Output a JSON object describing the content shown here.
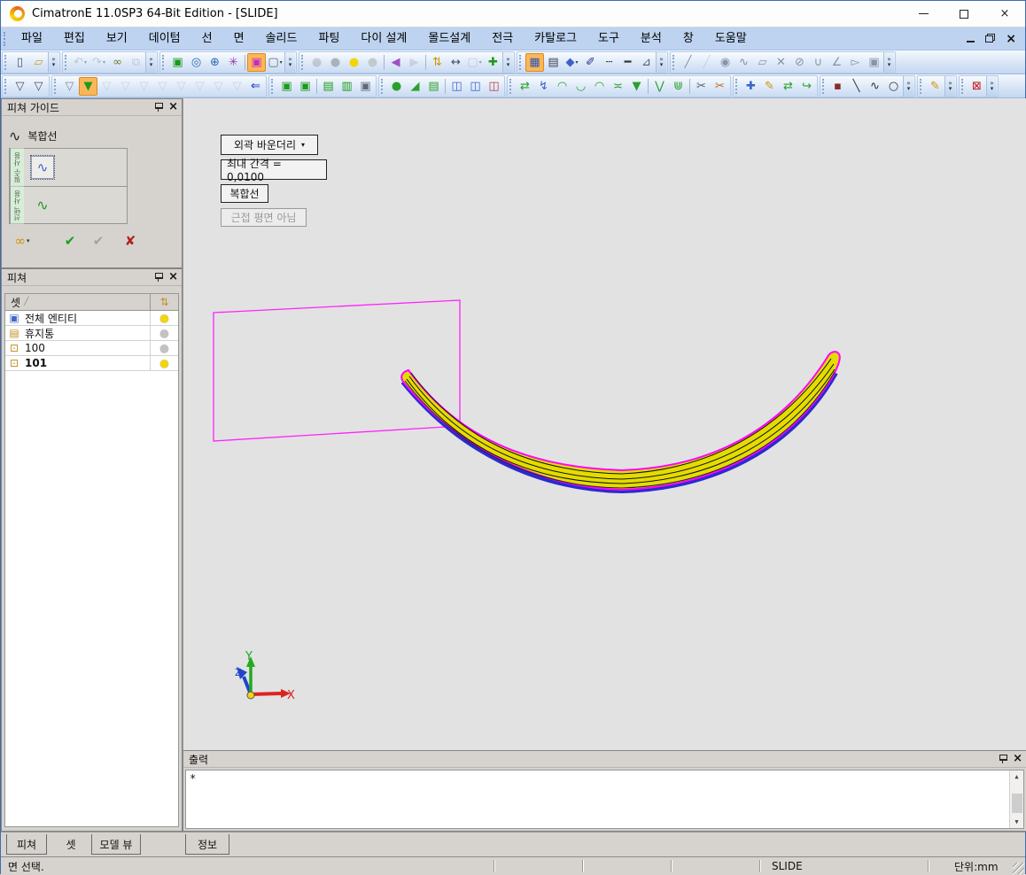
{
  "window": {
    "title": "CimatronE 11.0SP3 64-Bit Edition - [SLIDE]",
    "close_glyph": "×"
  },
  "menu": {
    "items": [
      "파일",
      "편집",
      "보기",
      "데이텀",
      "선",
      "면",
      "솔리드",
      "파팅",
      "다이 설계",
      "몰드설계",
      "전극",
      "카탈로그",
      "도구",
      "분석",
      "창",
      "도움말"
    ],
    "doc_close_glyph": "×"
  },
  "toolbars": {
    "row1": [
      {
        "name": "file",
        "overflow": true,
        "icons": [
          {
            "n": "new-file-icon",
            "g": "▯",
            "c": "#445a77"
          },
          {
            "n": "open-file-icon",
            "g": "▱",
            "c": "#d49a1a"
          }
        ]
      },
      {
        "name": "edit",
        "overflow": true,
        "icons": [
          {
            "n": "undo-icon",
            "g": "↶",
            "c": "#8899aa",
            "gray": 1,
            "dd": 1
          },
          {
            "n": "redo-icon",
            "g": "↷",
            "c": "#8899aa",
            "gray": 1,
            "dd": 1
          },
          {
            "n": "entity-links-icon",
            "g": "∞",
            "c": "#6a7d2e"
          },
          {
            "n": "copy-geometry-icon",
            "g": "⧉",
            "c": "#99a0aa",
            "gray": 1
          }
        ]
      },
      {
        "name": "view",
        "overflow": true,
        "icons": [
          {
            "n": "zoom-all-icon",
            "g": "▣",
            "c": "#1d9a1d"
          },
          {
            "n": "zoom-dynamic-icon",
            "g": "◎",
            "c": "#2a6ab0"
          },
          {
            "n": "zoom-window-icon",
            "g": "⊕",
            "c": "#2a6ab0"
          },
          {
            "n": "orbit-view-icon",
            "g": "✳",
            "c": "#9a35a8"
          },
          {
            "sep": 1
          },
          {
            "n": "shaded-mode-icon",
            "g": "▣",
            "c": "#c52cc5",
            "hl": 1
          },
          {
            "n": "wireframe-mode-icon",
            "g": "▢",
            "c": "#606a78",
            "dd": 1
          }
        ]
      },
      {
        "name": "visibility",
        "overflow": true,
        "icons": [
          {
            "n": "hide-by-cursor-icon",
            "g": "●",
            "c": "#9aa0a8",
            "gray": 1
          },
          {
            "n": "bulb-off-icon",
            "g": "●",
            "c": "#aab2ba"
          },
          {
            "n": "bulb-on-icon",
            "g": "●",
            "c": "#f2d50a"
          },
          {
            "n": "show-by-cursor-icon",
            "g": "●",
            "c": "#c3c9cf"
          },
          {
            "sep": 1
          },
          {
            "n": "previous-display-icon",
            "g": "◀",
            "c": "#a050c0"
          },
          {
            "n": "next-display-icon",
            "g": "▶",
            "c": "#aeb6be",
            "gray": 1
          },
          {
            "sep": 1
          },
          {
            "n": "swap-visibility-icon",
            "g": "⇅",
            "c": "#cf9400"
          },
          {
            "n": "measure-icon",
            "g": "↔",
            "c": "#44506a"
          },
          {
            "n": "box-display-icon",
            "g": "▢",
            "c": "#99a0aa",
            "gray": 1,
            "dd": 1
          },
          {
            "n": "add-part-icon",
            "g": "✚",
            "c": "#1d9a1d"
          }
        ]
      },
      {
        "name": "attributes",
        "overflow": true,
        "icons": [
          {
            "n": "uv-lines-icon",
            "g": "▦",
            "c": "#2a5ab8",
            "hl": 1
          },
          {
            "n": "color-table-icon",
            "g": "▤",
            "c": "#3a4250"
          },
          {
            "n": "fill-color-icon",
            "g": "◆",
            "c": "#3a62c8",
            "dd": 1
          },
          {
            "n": "pick-attribute-icon",
            "g": "✐",
            "c": "#24368a"
          },
          {
            "n": "line-style-icon",
            "g": "┄",
            "c": "#333333"
          },
          {
            "n": "line-width-icon",
            "g": "━",
            "c": "#333333"
          },
          {
            "n": "paint-attributes-icon",
            "g": "⊿",
            "c": "#50607a"
          }
        ]
      },
      {
        "name": "snap",
        "overflow": true,
        "icons": [
          {
            "n": "snap-endpoint-icon",
            "g": "╱",
            "c": "#8892a8"
          },
          {
            "n": "snap-midpoint-icon",
            "g": "╱",
            "c": "#aab2ba",
            "gray": 1
          },
          {
            "n": "snap-center-icon",
            "g": "◉",
            "c": "#8892a8"
          },
          {
            "n": "snap-spline-icon",
            "g": "∿",
            "c": "#8892a8"
          },
          {
            "n": "snap-plane-icon",
            "g": "▱",
            "c": "#8892a8"
          },
          {
            "n": "snap-intersection-icon",
            "g": "✕",
            "c": "#8892a8"
          },
          {
            "n": "snap-hidden-icon",
            "g": "⊘",
            "c": "#8892a8"
          },
          {
            "n": "snap-on-curve-icon",
            "g": "∪",
            "c": "#8892a8"
          },
          {
            "n": "snap-axis-icon",
            "g": "∠",
            "c": "#8892a8"
          },
          {
            "n": "snap-free-icon",
            "g": "▻",
            "c": "#8892a8"
          },
          {
            "n": "snap-grid-icon",
            "g": "▣",
            "c": "#8892a8"
          }
        ]
      }
    ],
    "row2": [
      {
        "name": "filter-pick",
        "icons": [
          {
            "n": "filter-by-cursor-icon",
            "g": "▽",
            "c": "#44506a"
          },
          {
            "n": "filter-add-icon",
            "g": "▽",
            "c": "#44506a"
          }
        ]
      },
      {
        "name": "filters",
        "icons": [
          {
            "n": "filter-copies-icon",
            "g": "▽",
            "c": "#7a88a0"
          },
          {
            "n": "filter-active-icon",
            "g": "▼",
            "c": "#1d9a1d",
            "hl": 1
          },
          {
            "n": "filter-curves-icon",
            "g": "▽",
            "c": "#aab2ba",
            "gray": 1
          },
          {
            "n": "filter-arcs-icon",
            "g": "▽",
            "c": "#aab2ba",
            "gray": 1
          },
          {
            "n": "filter-points-icon",
            "g": "▽",
            "c": "#aab2ba",
            "gray": 1
          },
          {
            "n": "filter-planes-icon",
            "g": "▽",
            "c": "#aab2ba",
            "gray": 1
          },
          {
            "n": "filter-surfaces-icon",
            "g": "▽",
            "c": "#aab2ba",
            "gray": 1
          },
          {
            "n": "filter-solids-icon",
            "g": "▽",
            "c": "#aab2ba",
            "gray": 1
          },
          {
            "n": "filter-sets-icon",
            "g": "▽",
            "c": "#aab2ba",
            "gray": 1
          },
          {
            "n": "filter-dimensions-icon",
            "g": "▽",
            "c": "#aab2ba",
            "gray": 1
          },
          {
            "n": "filter-reset-icon",
            "g": "⇐",
            "c": "#1133cc"
          }
        ]
      },
      {
        "name": "sets",
        "icons": [
          {
            "n": "create-set-icon",
            "g": "▣",
            "c": "#1d9a1d"
          },
          {
            "n": "load-set-icon",
            "g": "▣",
            "c": "#1d9a1d"
          },
          {
            "sep": 1
          },
          {
            "n": "open-box-icon",
            "g": "▤",
            "c": "#1d9a1d"
          },
          {
            "n": "copy-box-icon",
            "g": "▥",
            "c": "#1d9a1d"
          },
          {
            "n": "frame-box-icon",
            "g": "▣",
            "c": "#606a78"
          }
        ]
      },
      {
        "name": "solids",
        "icons": [
          {
            "n": "solid-fillet-icon",
            "g": "●",
            "c": "#2ca02c"
          },
          {
            "n": "solid-chamfer-icon",
            "g": "◢",
            "c": "#2ca02c"
          },
          {
            "n": "solid-open-icon",
            "g": "▤",
            "c": "#2ca02c"
          },
          {
            "sep": 1
          },
          {
            "n": "split-one-icon",
            "g": "◫",
            "c": "#3a62c8"
          },
          {
            "n": "split-two-icon",
            "g": "◫",
            "c": "#3a62c8"
          },
          {
            "n": "split-three-icon",
            "g": "◫",
            "c": "#c23a3a"
          }
        ]
      },
      {
        "name": "surfaces",
        "icons": [
          {
            "n": "surface-offset-icon",
            "g": "⇄",
            "c": "#2ca02c"
          },
          {
            "n": "surface-twist-icon",
            "g": "↯",
            "c": "#3a62c8"
          },
          {
            "n": "surface-dome-icon",
            "g": "◠",
            "c": "#2ca02c"
          },
          {
            "n": "surface-bend-icon",
            "g": "◡",
            "c": "#2ca02c"
          },
          {
            "n": "surface-flange-icon",
            "g": "◠",
            "c": "#2ca02c"
          },
          {
            "n": "surface-extend-icon",
            "g": "≍",
            "c": "#2ca02c"
          },
          {
            "n": "surface-funnel-icon",
            "g": "▼",
            "c": "#2ca02c"
          },
          {
            "sep": 1
          },
          {
            "n": "trim-icon",
            "g": "⋁",
            "c": "#2ca02c"
          },
          {
            "n": "untrim-icon",
            "g": "⋓",
            "c": "#2ca02c"
          },
          {
            "sep": 1
          },
          {
            "n": "cut-by-curve-icon",
            "g": "✂",
            "c": "#50607a"
          },
          {
            "n": "cut-by-plane-icon",
            "g": "✂",
            "c": "#c06a1a"
          }
        ]
      },
      {
        "name": "transform",
        "icons": [
          {
            "n": "move-icon",
            "g": "✚",
            "c": "#3a62c8"
          },
          {
            "n": "move-edit-icon",
            "g": "✎",
            "c": "#cf9400"
          },
          {
            "n": "mirror-icon",
            "g": "⇄",
            "c": "#2ca02c"
          },
          {
            "n": "transform-arrow-icon",
            "g": "↪",
            "c": "#2ca02c"
          }
        ]
      },
      {
        "name": "wire-geometry",
        "overflow": true,
        "icons": [
          {
            "n": "point-icon",
            "g": "▪",
            "c": "#8a2a2a"
          },
          {
            "n": "line-icon",
            "g": "╲",
            "c": "#333333"
          },
          {
            "n": "spline-icon",
            "g": "∿",
            "c": "#333333"
          },
          {
            "n": "circle-icon",
            "g": "○",
            "c": "#333333"
          }
        ]
      },
      {
        "name": "sketcher",
        "overflow": true,
        "icons": [
          {
            "n": "sketcher-icon",
            "g": "✎",
            "c": "#cf9400"
          }
        ]
      },
      {
        "name": "delete",
        "overflow": true,
        "icons": [
          {
            "n": "delete-entities-icon",
            "g": "⊠",
            "c": "#cc1111"
          }
        ]
      }
    ]
  },
  "guide_panel": {
    "title": "피쳐 가이드",
    "close_glyph": "×",
    "feature": {
      "icon": "∿",
      "label": "복합선"
    },
    "rows": [
      {
        "label": "필수 사용",
        "icon": "∿"
      },
      {
        "label": "선택 사용",
        "icon": "∿"
      }
    ],
    "actions": {
      "preview": {
        "glyph": "∞",
        "arrow": "▾"
      },
      "ok": {
        "glyph": "✔"
      },
      "apply": {
        "glyph": "✔"
      },
      "cancel": {
        "glyph": "✘"
      }
    }
  },
  "feature_panel": {
    "title": "피쳐",
    "close_glyph": "×",
    "header": {
      "set_col": "셋",
      "sort": "╱",
      "settings_glyph": "⇅"
    },
    "bulb_glyph": "●",
    "rows": [
      {
        "glyph": "▣",
        "glyph_style": "color:#4468c8",
        "label": "전체 엔티티",
        "bulb_style": "color:#f2d50a"
      },
      {
        "glyph": "▤",
        "glyph_style": "color:#c09020",
        "label": "휴지통",
        "bulb_style": "color:#c2c2c2"
      },
      {
        "glyph": "⊡",
        "glyph_style": "color:#c09020",
        "label": "100",
        "bulb_style": "color:#c2c2c2"
      },
      {
        "glyph": "⊡",
        "glyph_style": "color:#c09020",
        "label": "101",
        "label_style": "font-weight:bold",
        "bulb_style": "color:#f2d50a"
      }
    ]
  },
  "canvas": {
    "buttons": [
      {
        "label": "외곽 바운더리",
        "arrow": "▾"
      },
      {
        "label": "최대 간격 =  0,0100"
      },
      {
        "label": "복합선"
      },
      {
        "label": "근접 평면 아님",
        "style": "color:#9a9a9a;border-color:#9a9a9a;background:#ececec"
      }
    ],
    "axes": {
      "x": "X",
      "y": "Y",
      "z": "Z"
    },
    "colors": {
      "outline": "#ff00ff",
      "fill": "#e4dc00",
      "edge_blue": "#2a2ad0",
      "contour": "#111111"
    }
  },
  "output_panel": {
    "title": "출력",
    "close_glyph": "×",
    "content": "*",
    "tab": "정보"
  },
  "left_tabs": {
    "feature": "피쳐",
    "set": "셋",
    "model_view": "모델 뷰"
  },
  "status_bar": {
    "message": "면 선택.",
    "doc_name": "SLIDE",
    "units": "단위:mm"
  }
}
